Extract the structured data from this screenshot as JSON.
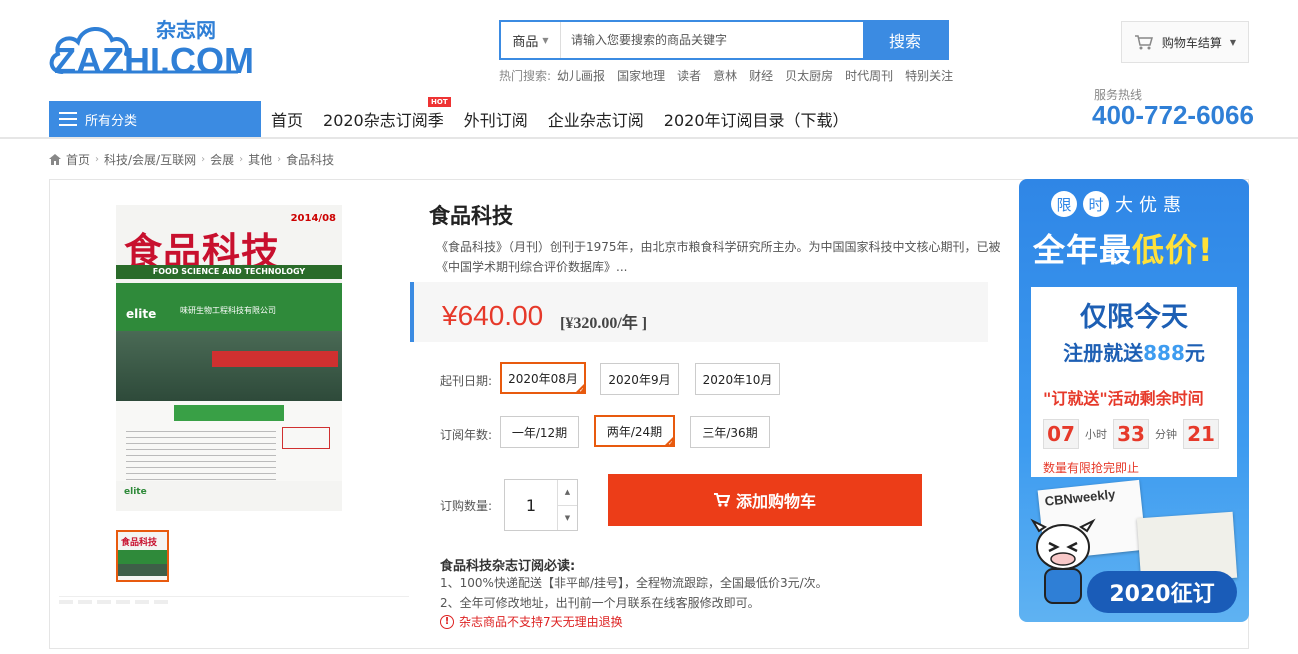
{
  "header": {
    "logo_text": "ZAZHI.COM",
    "logo_sub": "杂志网",
    "search": {
      "category": "商品",
      "placeholder": "请输入您要搜索的商品关键字",
      "button": "搜索"
    },
    "hot_search_label": "热门搜索:",
    "hot_search": [
      "幼儿画报",
      "国家地理",
      "读者",
      "意林",
      "财经",
      "贝太厨房",
      "时代周刊",
      "特别关注"
    ],
    "cart_label": "购物车结算"
  },
  "nav": {
    "all_categories": "所有分类",
    "items": [
      "首页",
      "2020杂志订阅季",
      "外刊订阅",
      "企业杂志订阅",
      "2020年订阅目录（下载）"
    ],
    "hot_badge": "HOT",
    "hotline_label": "服务热线",
    "hotline": "400-772-6066"
  },
  "breadcrumb": [
    "首页",
    "科技/会展/互联网",
    "会展",
    "其他",
    "食品科技"
  ],
  "product": {
    "title": "食品科技",
    "description": "《食品科技》（月刊）创刊于1975年，由北京市粮食科学研究所主办。为中国国家科技中文核心期刊，已被《中国学术期刊综合评价数据库》...",
    "price": "¥640.00",
    "price_per_year": "[¥320.00/年 ]",
    "start_date_label": "起刊日期:",
    "start_dates": [
      "2020年08月",
      "2020年9月",
      "2020年10月"
    ],
    "years_label": "订阅年数:",
    "years": [
      "一年/12期",
      "两年/24期",
      "三年/36期"
    ],
    "qty_label": "订购数量:",
    "qty": "1",
    "add_to_cart": "添加购物车",
    "notice_title": "食品科技杂志订阅必读:",
    "notice_1": "1、100%快递配送【非平邮/挂号】，全程物流跟踪，全国最低价3元/次。",
    "notice_2": "2、全年可修改地址，出刊前一个月联系在线客服修改即可。",
    "notice_warn": "杂志商品不支持7天无理由退换"
  },
  "cover": {
    "title": "食品科技",
    "issue": "2014/08",
    "english": "FOOD SCIENCE AND TECHNOLOGY",
    "brand": "elite",
    "brand_cn": "味研生物工程科技有限公司",
    "footer_brand": "elite"
  },
  "promo": {
    "limited_chars": [
      "限",
      "时",
      "大",
      "优",
      "惠"
    ],
    "big_prefix": "全年最",
    "big_highlight": "低价!",
    "today": "仅限今天",
    "register_prefix": "注册就送",
    "register_amount": "888",
    "register_suffix": "元",
    "activity": "\"订就送\"活动剩余时间",
    "hours": "07",
    "hours_label": "小时",
    "minutes": "33",
    "minutes_label": "分钟",
    "seconds": "21",
    "limit_text": "数量有限抢完即止",
    "magazine_name": "CBNweekly",
    "year_button": "2020征订"
  },
  "colors": {
    "brand_blue": "#3b8be2",
    "price_red": "#e6392a",
    "cart_orange": "#ec3d18",
    "selected_border": "#e85a0e"
  }
}
